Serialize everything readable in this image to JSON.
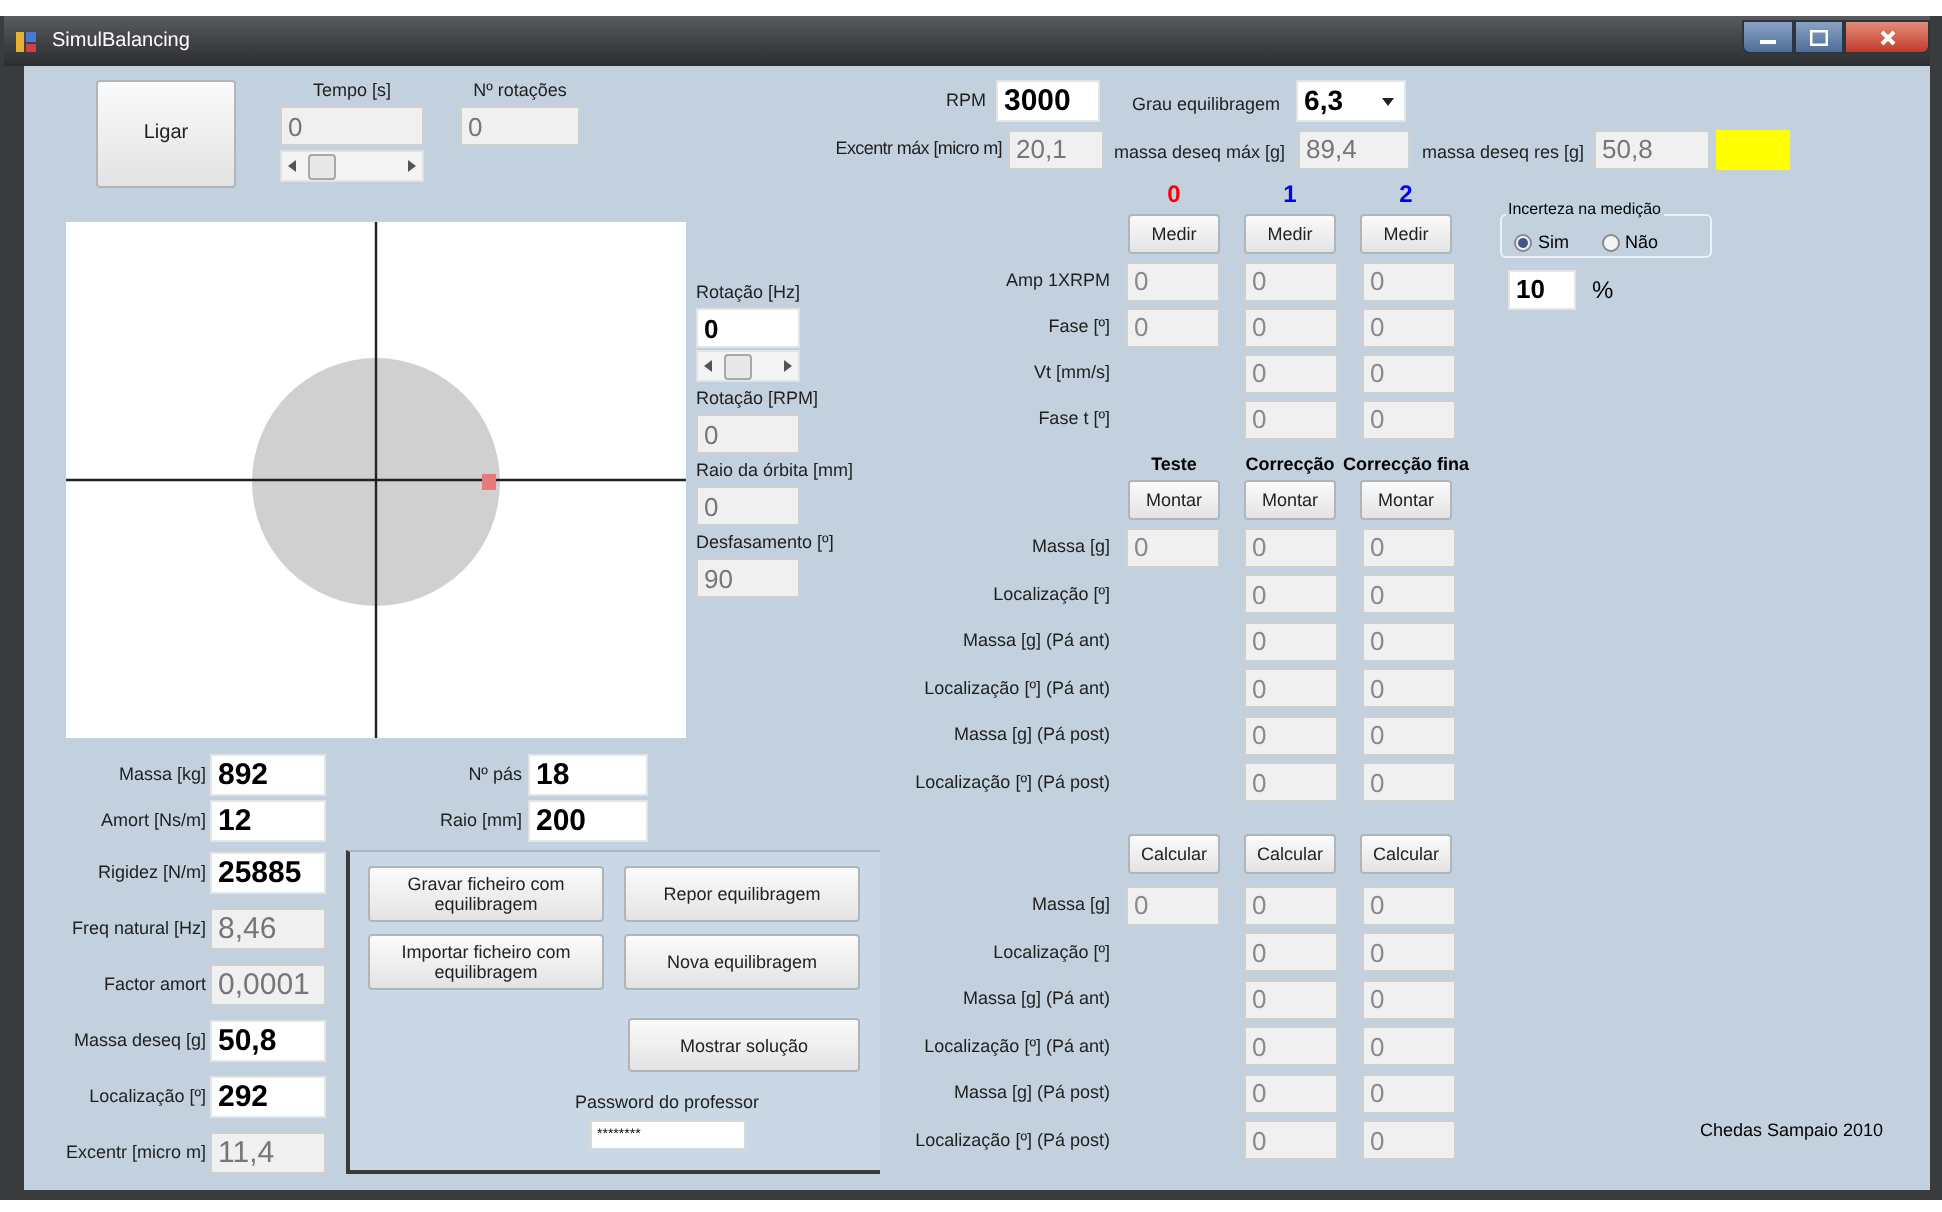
{
  "window": {
    "title": "SimulBalancing"
  },
  "start_button": {
    "label": "Ligar"
  },
  "time": {
    "label": "Tempo [s]",
    "value": "0",
    "readonly": true
  },
  "rotations": {
    "label": "Nº rotações",
    "value": "0",
    "readonly": true
  },
  "rpm": {
    "label": "RPM",
    "value": "3000",
    "readonly": false
  },
  "balance_grade": {
    "label": "Grau equilibragem",
    "value": "6,3"
  },
  "excentr_max": {
    "label": "Excentr máx [micro m]",
    "value": "20,1",
    "readonly": true
  },
  "unbalance_max": {
    "label": "massa deseq máx [g]",
    "value": "89,4",
    "readonly": true
  },
  "unbalance_res": {
    "label": "massa deseq res [g]",
    "value": "50,8",
    "readonly": true
  },
  "side_fields": [
    {
      "label": "Rotação [Hz]",
      "value": "0",
      "readonly": false
    },
    {
      "label": "Rotação [RPM]",
      "value": "0",
      "readonly": true
    },
    {
      "label": "Raio da órbita [mm]",
      "value": "0",
      "readonly": true
    },
    {
      "label": "Desfasamento [º]",
      "value": "90",
      "readonly": true
    }
  ],
  "measurement": {
    "columns": [
      {
        "label": "0",
        "color": "#ff0000"
      },
      {
        "label": "1",
        "color": "#0000ff"
      },
      {
        "label": "2",
        "color": "#0000ff"
      }
    ],
    "buttons": [
      "Medir",
      "Medir",
      "Medir"
    ],
    "rows": [
      {
        "label": "Amp 1XRPM",
        "cells": [
          "0",
          "0",
          "0"
        ]
      },
      {
        "label": "Fase [º]",
        "cells": [
          "0",
          "0",
          "0"
        ]
      },
      {
        "label": "Vt [mm/s]",
        "cells": [
          null,
          "0",
          "0"
        ]
      },
      {
        "label": "Fase t [º]",
        "cells": [
          null,
          "0",
          "0"
        ]
      }
    ]
  },
  "correction": {
    "columns": [
      "Teste",
      "Correcção",
      "Correcção fina"
    ],
    "buttons": [
      "Montar",
      "Montar",
      "Montar"
    ],
    "rows": [
      {
        "label": "Massa [g]",
        "cells": [
          "0",
          "0",
          "0"
        ]
      },
      {
        "label": "Localização [º]",
        "cells": [
          null,
          "0",
          "0"
        ]
      },
      {
        "label": "Massa [g] (Pá ant)",
        "cells": [
          null,
          "0",
          "0"
        ]
      },
      {
        "label": "Localização [º] (Pá ant)",
        "cells": [
          null,
          "0",
          "0"
        ]
      },
      {
        "label": "Massa [g] (Pá post)",
        "cells": [
          null,
          "0",
          "0"
        ]
      },
      {
        "label": "Localização [º] (Pá post)",
        "cells": [
          null,
          "0",
          "0"
        ]
      }
    ]
  },
  "calculation": {
    "buttons": [
      "Calcular",
      "Calcular",
      "Calcular"
    ],
    "rows": [
      {
        "label": "Massa [g]",
        "cells": [
          "0",
          "0",
          "0"
        ]
      },
      {
        "label": "Localização [º]",
        "cells": [
          null,
          "0",
          "0"
        ]
      },
      {
        "label": "Massa [g] (Pá ant)",
        "cells": [
          null,
          "0",
          "0"
        ]
      },
      {
        "label": "Localização [º] (Pá ant)",
        "cells": [
          null,
          "0",
          "0"
        ]
      },
      {
        "label": "Massa [g] (Pá post)",
        "cells": [
          null,
          "0",
          "0"
        ]
      },
      {
        "label": "Localização [º] (Pá post)",
        "cells": [
          null,
          "0",
          "0"
        ]
      }
    ]
  },
  "uncertainty": {
    "title": "Incerteza na medição",
    "options": [
      {
        "label": "Sim",
        "selected": true
      },
      {
        "label": "Não",
        "selected": false
      }
    ],
    "value": "10",
    "unit": "%"
  },
  "rotor_fields": [
    {
      "label": "Massa [kg]",
      "value": "892",
      "readonly": false
    },
    {
      "label": "Amort [Ns/m]",
      "value": "12",
      "readonly": false
    },
    {
      "label": "Rigidez [N/m]",
      "value": "25885",
      "readonly": false
    },
    {
      "label": "Freq natural [Hz]",
      "value": "8,46",
      "readonly": true
    },
    {
      "label": "Factor amort",
      "value": "0,0001",
      "readonly": true
    },
    {
      "label": "Massa deseq [g]",
      "value": "50,8",
      "readonly": false
    },
    {
      "label": "Localização [º]",
      "value": "292",
      "readonly": false
    },
    {
      "label": "Excentr [micro m]",
      "value": "11,4",
      "readonly": true
    }
  ],
  "blade_fields": [
    {
      "label": "Nº pás",
      "value": "18",
      "readonly": false
    },
    {
      "label": "Raio [mm]",
      "value": "200",
      "readonly": false
    }
  ],
  "actions": [
    "Gravar ficheiro com equilibragem",
    "Repor equilibragem",
    "Importar ficheiro com equilibragem",
    "Nova equilibragem",
    "Mostrar solução"
  ],
  "password": {
    "label": "Password do professor",
    "value": "********"
  },
  "footer": "Chedas Sampaio 2010"
}
